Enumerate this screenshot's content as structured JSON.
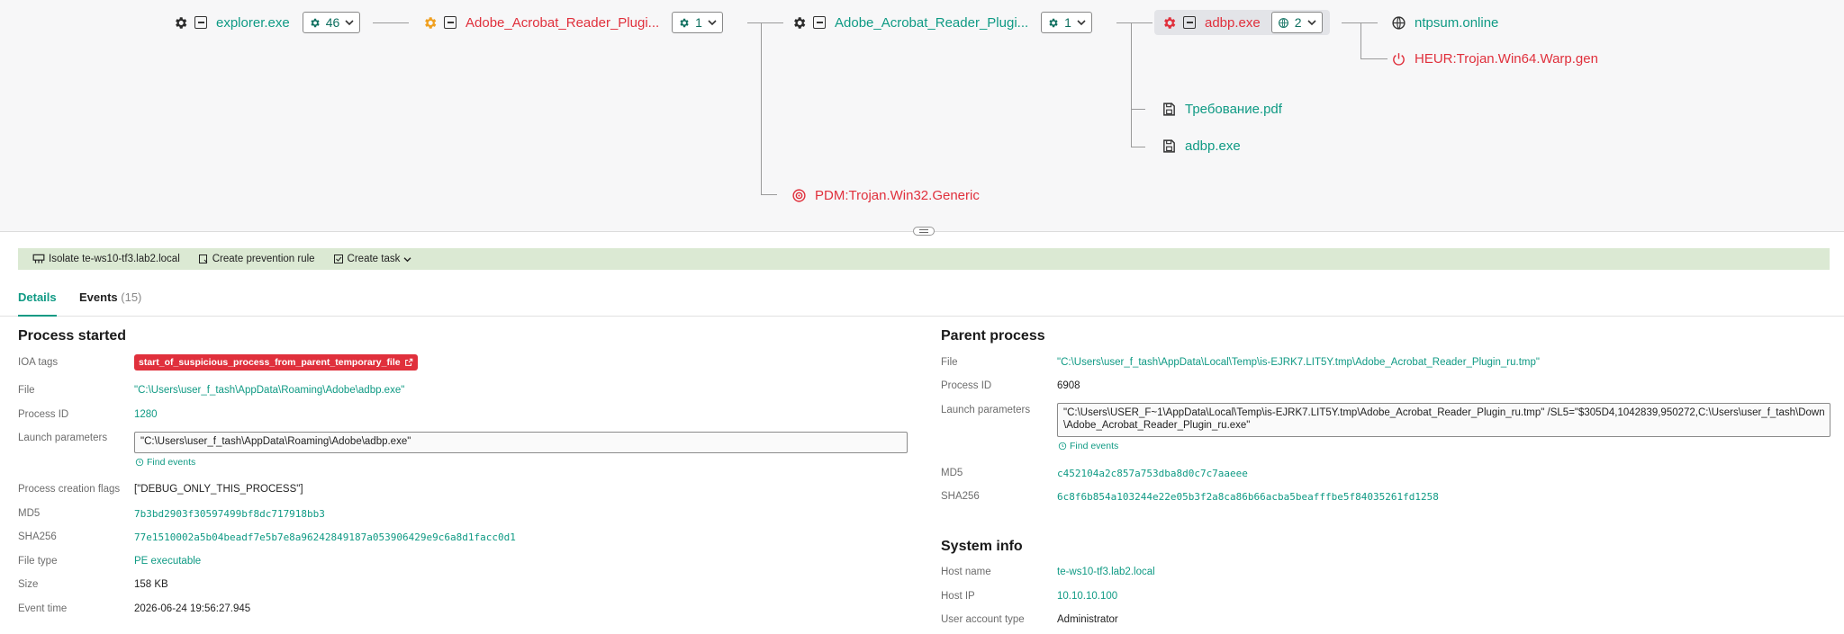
{
  "tree": {
    "nodes": [
      {
        "label": "explorer.exe",
        "count": "46"
      },
      {
        "label": "Adobe_Acrobat_Reader_Plugi...",
        "count": "1"
      },
      {
        "label": "Adobe_Acrobat_Reader_Plugi...",
        "count": "1"
      },
      {
        "label": "adbp.exe",
        "count": "2"
      },
      {
        "label": "ntpsum.online"
      },
      {
        "label": "HEUR:Trojan.Win64.Warp.gen"
      },
      {
        "label": "Требование.pdf"
      },
      {
        "label": "adbp.exe"
      },
      {
        "label": "PDM:Trojan.Win32.Generic"
      }
    ]
  },
  "actions": {
    "isolate": "Isolate te-ws10-tf3.lab2.local",
    "prevention": "Create prevention rule",
    "task": "Create task"
  },
  "tabs": {
    "details": "Details",
    "events": "Events",
    "events_count": "(15)"
  },
  "process_started": {
    "title": "Process started",
    "ioa_label": "IOA tags",
    "ioa_tag": "start_of_suspicious_process_from_parent_temporary_file",
    "file_label": "File",
    "file": "\"C:\\Users\\user_f_tash\\AppData\\Roaming\\Adobe\\adbp.exe\"",
    "pid_label": "Process ID",
    "pid": "1280",
    "launch_label": "Launch parameters",
    "launch": "\"C:\\Users\\user_f_tash\\AppData\\Roaming\\Adobe\\adbp.exe\"",
    "find_events": "Find events",
    "flags_label": "Process creation flags",
    "flags": "[\"DEBUG_ONLY_THIS_PROCESS\"]",
    "md5_label": "MD5",
    "md5": "7b3bd2903f30597499bf8dc717918bb3",
    "sha_label": "SHA256",
    "sha": "77e1510002a5b04beadf7e5b7e8a96242849187a053906429e9c6a8d1facc0d1",
    "ftype_label": "File type",
    "ftype": "PE executable",
    "size_label": "Size",
    "size": "158 KB",
    "time_label": "Event time",
    "time": "2026-06-24 19:56:27.945"
  },
  "parent_process": {
    "title": "Parent process",
    "file_label": "File",
    "file": "\"C:\\Users\\user_f_tash\\AppData\\Local\\Temp\\is-EJRK7.LIT5Y.tmp\\Adobe_Acrobat_Reader_Plugin_ru.tmp\"",
    "pid_label": "Process ID",
    "pid": "6908",
    "launch_label": "Launch parameters",
    "launch_line1": "\"C:\\Users\\USER_F~1\\AppData\\Local\\Temp\\is-EJRK7.LIT5Y.tmp\\Adobe_Acrobat_Reader_Plugin_ru.tmp\" /SL5=\"$305D4,1042839,950272,C:\\Users\\user_f_tash\\Downloads",
    "launch_line2": "\\Adobe_Acrobat_Reader_Plugin_ru.exe\"",
    "find_events": "Find events",
    "md5_label": "MD5",
    "md5": "c452104a2c857a753dba8d0c7c7aaeee",
    "sha_label": "SHA256",
    "sha": "6c8f6b854a103244e22e05b3f2a8ca86b66acba5beafffbe5f84035261fd1258"
  },
  "system_info": {
    "title": "System info",
    "host_label": "Host name",
    "host": "te-ws10-tf3.lab2.local",
    "ip_label": "Host IP",
    "ip": "10.10.10.100",
    "acct_label": "User account type",
    "acct": "Administrator"
  },
  "colors": {
    "teal": "#0f9a84",
    "red": "#e0303c",
    "orange": "#f0a020",
    "actionbar": "#dbe9d3"
  }
}
